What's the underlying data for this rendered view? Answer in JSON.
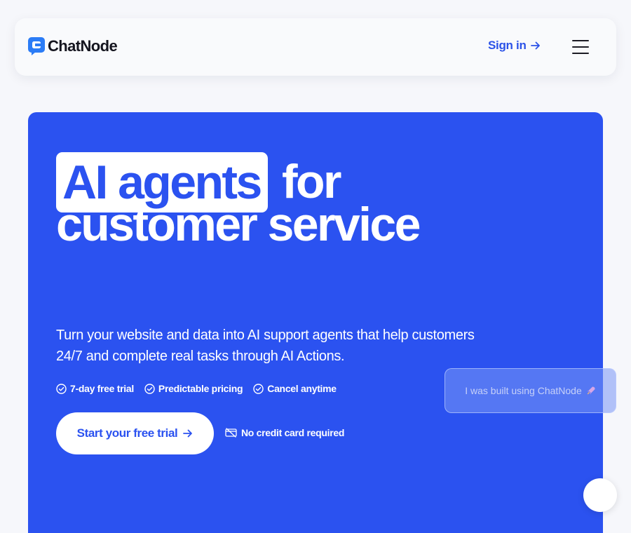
{
  "header": {
    "brand": "ChatNode",
    "signin_label": "Sign in",
    "logo_icon": "chat-bubble-logo-icon",
    "menu_icon": "hamburger-menu-icon"
  },
  "hero": {
    "headline_highlight": "AI agents",
    "headline_rest": "for",
    "headline_line2": "customer service",
    "subheading": "Turn your website and data into AI support agents that help customers 24/7 and complete real tasks through AI Actions.",
    "features": [
      "7-day free trial",
      "Predictable pricing",
      "Cancel anytime"
    ],
    "cta_label": "Start your free trial",
    "no_card_text": "No credit card required"
  },
  "widget": {
    "built_text": "I was built using ChatNode"
  },
  "colors": {
    "brand_blue": "#2b52f0",
    "text_dark": "#15151f",
    "page_bg": "#f6f7fb"
  }
}
